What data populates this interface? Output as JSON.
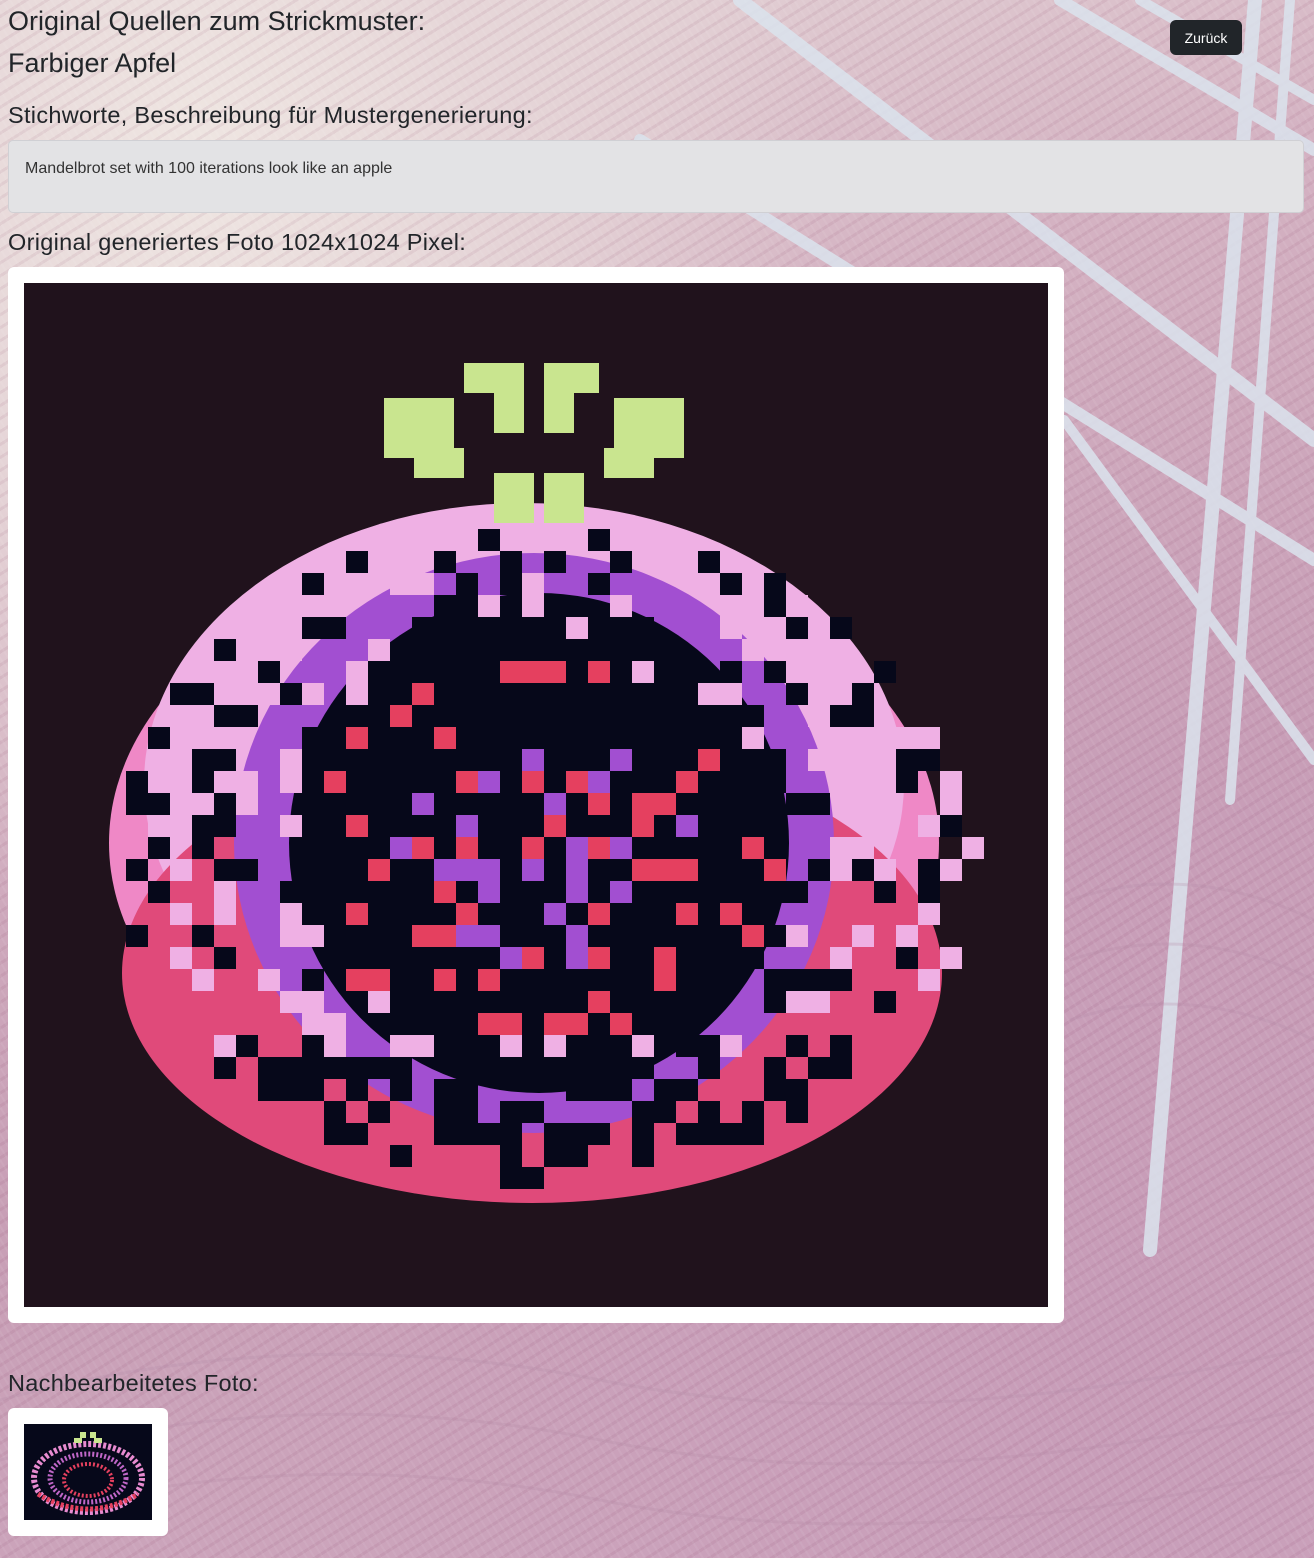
{
  "header": {
    "title_line1": "Original Quellen zum Strickmuster:",
    "title_line2": "Farbiger Apfel",
    "back_button_label": "Zurück"
  },
  "keywords": {
    "heading": "Stichworte, Beschreibung für Mustergenerierung:",
    "text": "Mandelbrot set with 100 iterations look like an apple"
  },
  "original_photo": {
    "heading": "Original generiertes Foto 1024x1024 Pixel:"
  },
  "processed_photo": {
    "heading": "Nachbearbeitetes Foto:"
  },
  "colors": {
    "button_bg": "#212529",
    "image_bg": "#20121c",
    "apple_core": "#06081a",
    "leaf_green": "#c9e58f",
    "pink_light": "#efb0e4",
    "pink": "#e87bc6",
    "purple": "#a24fd1",
    "red": "#e5405f",
    "salmon": "#ec8a82"
  }
}
